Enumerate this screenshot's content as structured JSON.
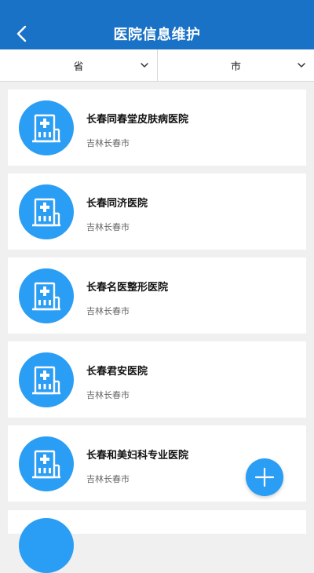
{
  "header": {
    "title": "医院信息维护",
    "back_icon": "chevron-left-icon"
  },
  "filters": {
    "province": "省",
    "city": "市"
  },
  "hospitals": [
    {
      "name": "长春同春堂皮肤病医院",
      "region": "吉林长春市"
    },
    {
      "name": "长春同济医院",
      "region": "吉林长春市"
    },
    {
      "name": "长春名医整形医院",
      "region": "吉林长春市"
    },
    {
      "name": "长春君安医院",
      "region": "吉林长春市"
    },
    {
      "name": "长春和美妇科专业医院",
      "region": "吉林长春市"
    }
  ],
  "fab": {
    "icon": "plus-icon"
  },
  "colors": {
    "header": "#1a72c7",
    "accent": "#2a9df4",
    "background": "#f0f0f0"
  }
}
